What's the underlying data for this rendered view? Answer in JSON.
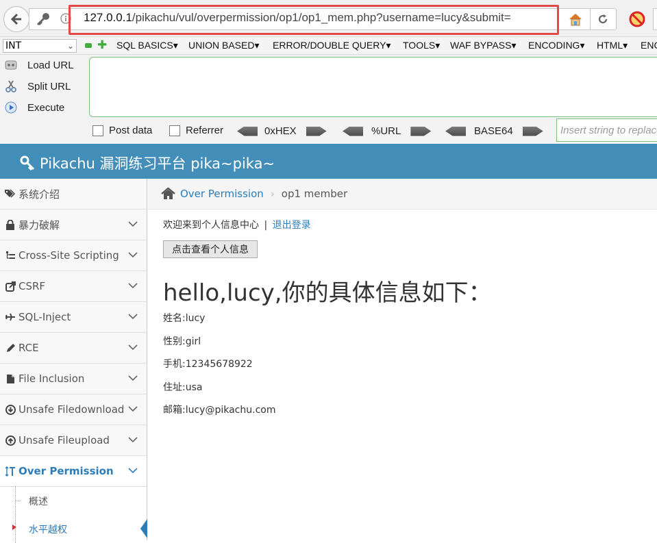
{
  "browser": {
    "url_host": "127.0.0.1",
    "url_path": "/pikachu/vul/overpermission/op1/op1_mem.php?username=lucy&submit="
  },
  "hackbar": {
    "mode_select": "INT",
    "menus": [
      "SQL BASICS",
      "UNION BASED",
      "ERROR/DOUBLE QUERY",
      "TOOLS",
      "WAF BYPASS",
      "ENCODING",
      "HTML",
      "ENC"
    ],
    "actions": {
      "load": "Load URL",
      "split": "Split URL",
      "execute": "Execute"
    },
    "post_data_label": "Post data",
    "referrer_label": "Referrer",
    "hex_label": "0xHEX",
    "url_label": "%URL",
    "base64_label": "BASE64",
    "replace_placeholder": "Insert string to replace"
  },
  "header": {
    "brand": "Pikachu 漏洞练习平台 pika~pika~"
  },
  "sidebar": {
    "items": [
      {
        "label": "系统介绍",
        "icon": "tags-icon"
      },
      {
        "label": "暴力破解",
        "icon": "lock-icon"
      },
      {
        "label": "Cross-Site Scripting",
        "icon": "sitemap-icon"
      },
      {
        "label": "CSRF",
        "icon": "external-link-icon"
      },
      {
        "label": "SQL-Inject",
        "icon": "plane-icon"
      },
      {
        "label": "RCE",
        "icon": "pencil-icon"
      },
      {
        "label": "File Inclusion",
        "icon": "file-icon"
      },
      {
        "label": "Unsafe Filedownload",
        "icon": "download-icon"
      },
      {
        "label": "Unsafe Fileupload",
        "icon": "upload-icon"
      },
      {
        "label": "Over Permission",
        "icon": "text-height-icon"
      }
    ],
    "sub_items": [
      {
        "label": "概述"
      },
      {
        "label": "水平越权"
      }
    ]
  },
  "breadcrumb": {
    "section": "Over Permission",
    "page": "op1 member"
  },
  "content": {
    "welcome": "欢迎来到个人信息中心",
    "separator": "|",
    "logout": "退出登录",
    "view_button": "点击查看个人信息",
    "hello": "hello,lucy,你的具体信息如下：",
    "fields": {
      "name": "姓名:lucy",
      "sex": "性别:girl",
      "phone": "手机:12345678922",
      "address": "住址:usa",
      "email": "邮箱:lucy@pikachu.com"
    }
  },
  "colors": {
    "header_bg": "#438eb9",
    "link": "#2b7dbc",
    "url_highlight": "#e24a4a"
  }
}
